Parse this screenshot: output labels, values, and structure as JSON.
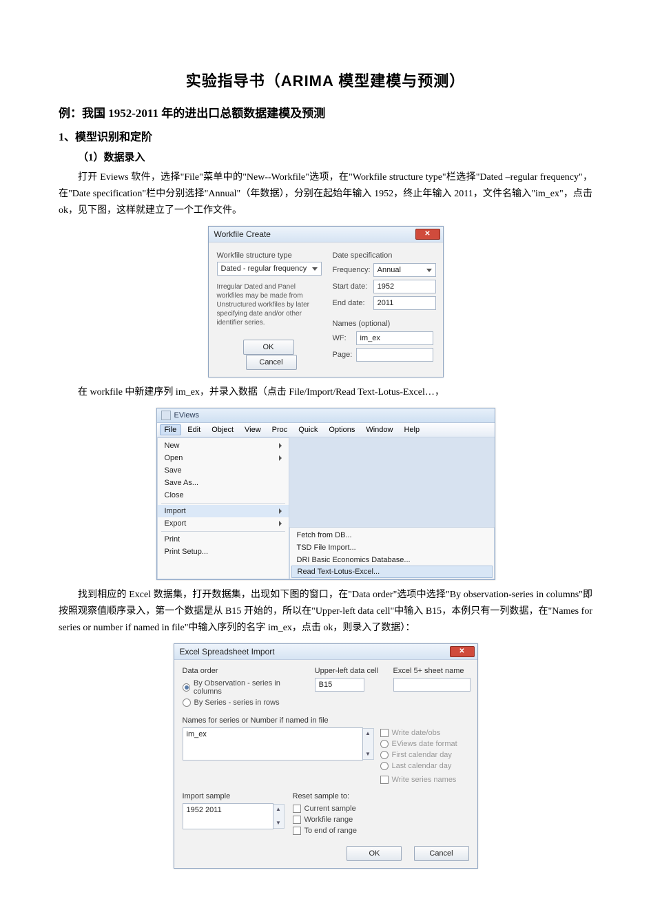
{
  "document": {
    "title": "实验指导书（ARIMA 模型建模与预测）",
    "example_heading": "例：我国 1952-2011 年的进出口总额数据建模及预测",
    "section1": "1、模型识别和定阶",
    "subsection1_1": "（1）数据录入",
    "para1": "打开 Eviews 软件，选择\"File\"菜单中的\"New--Workfile\"选项，在\"Workfile structure type\"栏选择\"Dated –regular frequency\"，在\"Date specification\"栏中分别选择\"Annual\"（年数据），分别在起始年输入 1952，终止年输入 2011，文件名输入\"im_ex\"，点击 ok，见下图，这样就建立了一个工作文件。",
    "para2": "在 workfile 中新建序列 im_ex，并录入数据（点击 File/Import/Read Text-Lotus-Excel…，",
    "para3": "找到相应的 Excel 数据集，打开数据集，出现如下图的窗口，在\"Data order\"选项中选择\"By observation-series in columns\"即按照观察值顺序录入，第一个数据是从 B15 开始的，所以在\"Upper-left data cell\"中输入 B15，本例只有一列数据，在\"Names for series or number if named in file\"中输入序列的名字 im_ex，点击 ok，则录入了数据）："
  },
  "workfile_dialog": {
    "title": "Workfile Create",
    "structure_label": "Workfile structure type",
    "structure_value": "Dated - regular frequency",
    "spec_label": "Date specification",
    "freq_label": "Frequency:",
    "freq_value": "Annual",
    "start_label": "Start date:",
    "start_value": "1952",
    "end_label": "End date:",
    "end_value": "2011",
    "note": "Irregular Dated and Panel workfiles may be made from Unstructured workfiles by later specifying date and/or other identifier series.",
    "names_label": "Names (optional)",
    "wf_label": "WF:",
    "wf_value": "im_ex",
    "page_label": "Page:",
    "ok": "OK",
    "cancel": "Cancel"
  },
  "eviews_menu": {
    "window_title": "EViews",
    "menubar": [
      "File",
      "Edit",
      "Object",
      "View",
      "Proc",
      "Quick",
      "Options",
      "Window",
      "Help"
    ],
    "file_items": [
      "New",
      "Open",
      "Save",
      "Save As...",
      "Close",
      "__sep__",
      "Import",
      "Export",
      "__sep__",
      "Print",
      "Print Setup..."
    ],
    "import_submenu": [
      "Fetch from DB...",
      "TSD File Import...",
      "DRI Basic Economics Database...",
      "Read Text-Lotus-Excel..."
    ]
  },
  "excel_import": {
    "title": "Excel Spreadsheet Import",
    "data_order_label": "Data order",
    "radio1": "By Observation - series in columns",
    "radio2": "By Series - series in rows",
    "upper_left_label": "Upper-left data cell",
    "upper_left_value": "B15",
    "sheet_label": "Excel 5+ sheet name",
    "names_label": "Names for series or Number if named in file",
    "names_value": "im_ex",
    "write_dateobs": "Write date/obs",
    "opt_eviews": "EViews date format",
    "opt_first": "First calendar day",
    "opt_last": "Last calendar day",
    "write_series": "Write series names",
    "import_sample_label": "Import sample",
    "import_sample_value": "1952 2011",
    "reset_label": "Reset sample to:",
    "reset_current": "Current sample",
    "reset_workfile": "Workfile range",
    "reset_end": "To end of range",
    "ok": "OK",
    "cancel": "Cancel"
  }
}
